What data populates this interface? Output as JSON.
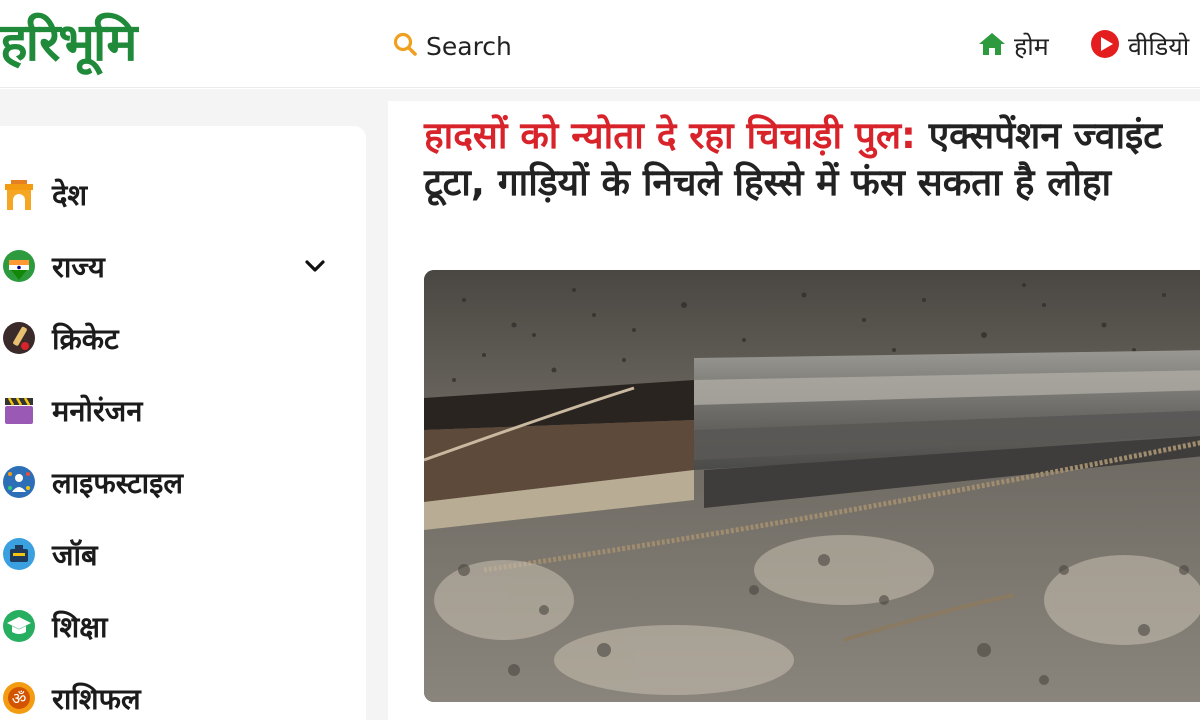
{
  "header": {
    "logo_text": "हरिभूमि",
    "search_label": "Search",
    "nav": {
      "home_label": "होम",
      "video_label": "वीडियो"
    }
  },
  "sidebar": {
    "items": [
      {
        "label": "देश",
        "icon": "india-gate-icon"
      },
      {
        "label": "राज्य",
        "icon": "india-map-icon",
        "has_dropdown": true
      },
      {
        "label": "क्रिकेट",
        "icon": "cricket-icon"
      },
      {
        "label": "मनोरंजन",
        "icon": "clapperboard-icon"
      },
      {
        "label": "लाइफस्टाइल",
        "icon": "lifestyle-icon"
      },
      {
        "label": "जॉब",
        "icon": "job-icon"
      },
      {
        "label": "शिक्षा",
        "icon": "education-icon"
      },
      {
        "label": "राशिफल",
        "icon": "om-icon"
      }
    ]
  },
  "article": {
    "headline_red": "हादसों को न्योता दे रहा चिचाड़ी पुल:",
    "headline_rest": " एक्सपेंशन ज्वाइंट टूटा, गाड़ियों के निचले हिस्से में फंस सकता है लोहा",
    "image_subject": "broken-expansion-joint-photo"
  },
  "colors": {
    "brand_green": "#1e8a3a",
    "headline_red": "#d8232a",
    "search_orange": "#f0a020",
    "video_red": "#e41e1e"
  }
}
